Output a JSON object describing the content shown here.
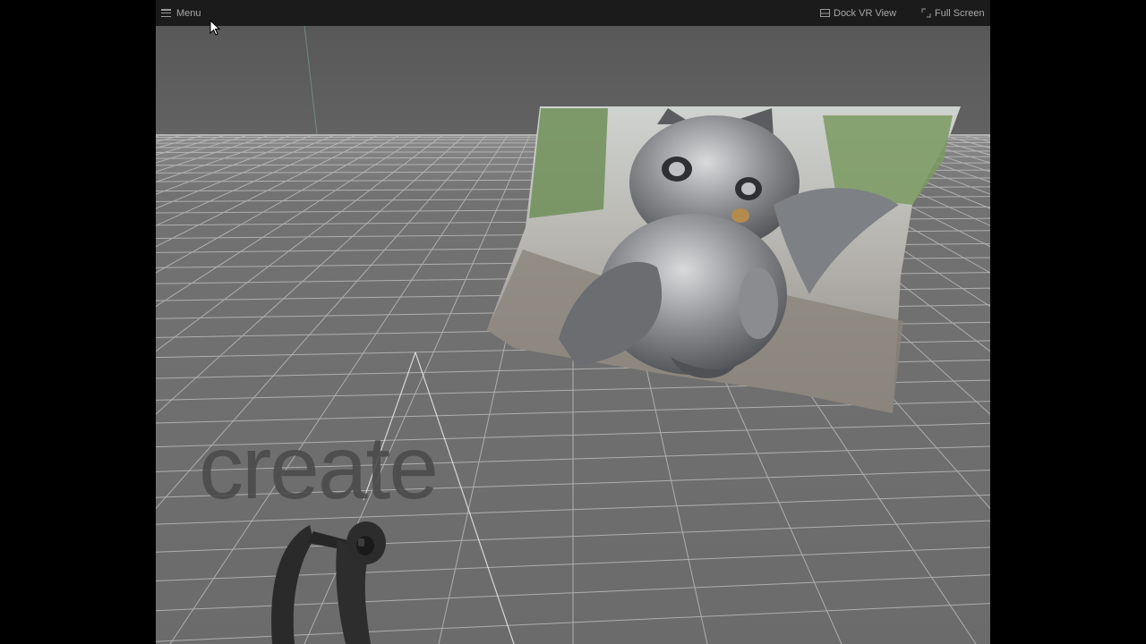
{
  "topbar": {
    "menu_label": "Menu",
    "dock_label": "Dock VR View",
    "fullscreen_label": "Full Screen"
  },
  "scene": {
    "text_3d": "create",
    "image_subject": "silver cat statue photo",
    "controller": "vr-controller",
    "colors": {
      "sky": "#5f5f5f",
      "floor": "#6b6b6b",
      "grid": "#bdbdbd",
      "text": "#4a4a4a"
    }
  },
  "icons": {
    "menu": "hamburger-icon",
    "dock": "dock-window-icon",
    "fullscreen": "expand-icon",
    "pointer": "cursor-icon"
  }
}
